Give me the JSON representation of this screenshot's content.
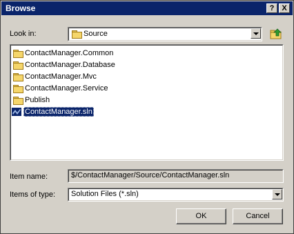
{
  "window": {
    "title": "Browse"
  },
  "titlebar": {
    "help_label": "?",
    "close_label": "X"
  },
  "look_in": {
    "label": "Look in:",
    "value": "Source"
  },
  "file_list": {
    "items": [
      {
        "label": "ContactManager.Common",
        "type": "folder"
      },
      {
        "label": "ContactManager.Database",
        "type": "folder"
      },
      {
        "label": "ContactManager.Mvc",
        "type": "folder"
      },
      {
        "label": "ContactManager.Service",
        "type": "folder"
      },
      {
        "label": "Publish",
        "type": "folder"
      },
      {
        "label": "ContactManager.sln",
        "type": "solution",
        "selected": true
      }
    ]
  },
  "item_name": {
    "label": "Item name:",
    "value": "$/ContactManager/Source/ContactManager.sln"
  },
  "items_of_type": {
    "label": "Items of type:",
    "value": "Solution Files (*.sln)"
  },
  "buttons": {
    "ok_label": "OK",
    "cancel_label": "Cancel"
  },
  "colors": {
    "titlebar": "#0a246a",
    "dialog_bg": "#d4d0c8",
    "selection": "#0a246a"
  }
}
